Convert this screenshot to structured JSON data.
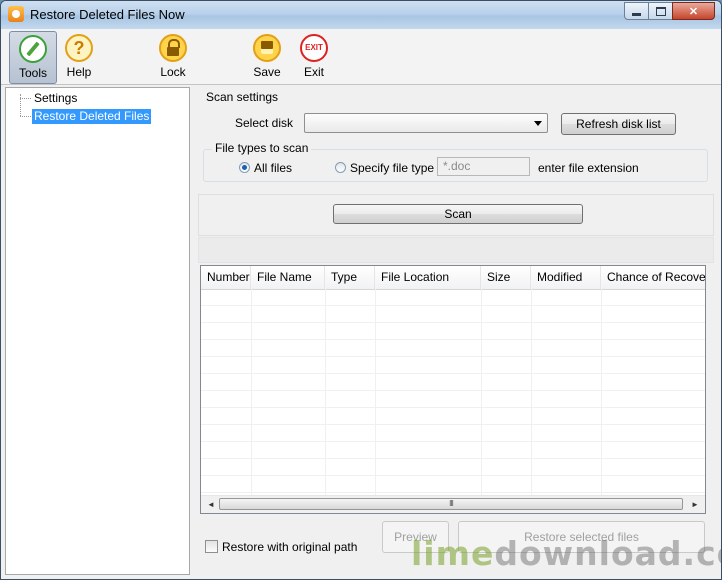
{
  "window": {
    "title": "Restore Deleted Files Now",
    "controls": {
      "minimize": "",
      "maximize": "",
      "close": "✕"
    }
  },
  "toolbar": {
    "items": [
      {
        "label": "Tools",
        "icon": "pencil-icon",
        "active": true
      },
      {
        "label": "Help",
        "icon": "help-icon",
        "glyph": "?"
      },
      {
        "label": "Lock",
        "icon": "lock-icon"
      },
      {
        "label": "Save",
        "icon": "floppy-icon"
      },
      {
        "label": "Exit",
        "icon": "exit-icon",
        "glyph": "EXIT"
      }
    ]
  },
  "tree": {
    "items": [
      {
        "label": "Settings",
        "selected": false
      },
      {
        "label": "Restore Deleted Files",
        "selected": true
      }
    ]
  },
  "scan_settings": {
    "title": "Scan settings",
    "select_disk_label": "Select disk",
    "select_disk_value": "",
    "refresh_button": "Refresh disk list",
    "file_types": {
      "title": "File types to scan",
      "all_files_label": "All files",
      "all_files_checked": true,
      "specify_label": "Specify file type",
      "specify_checked": false,
      "extension_value": "*.doc",
      "extension_hint": "enter file extension"
    }
  },
  "scan_button": "Scan",
  "results_table": {
    "columns": [
      "Number",
      "File Name",
      "Type",
      "File Location",
      "Size",
      "Modified",
      "Chance of Recovery"
    ],
    "rows": [],
    "scrollbar": {
      "left_arrow": "◄",
      "right_arrow": "►",
      "grip": "III"
    }
  },
  "bottom": {
    "restore_original_path_label": "Restore with original path",
    "restore_original_path_checked": false,
    "preview_button": "Preview",
    "restore_button": "Restore selected files"
  },
  "watermark": {
    "part1": "lime",
    "part2": "download.com"
  },
  "colors": {
    "selection": "#3399ff",
    "exit_red": "#dd2222",
    "icon_gold": "#e2a017",
    "tools_green": "#3aa13a"
  }
}
